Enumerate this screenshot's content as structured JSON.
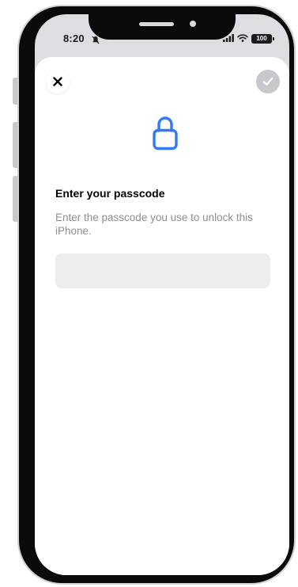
{
  "status_bar": {
    "time": "8:20",
    "battery": "100"
  },
  "sheet": {
    "close_icon": "close-icon",
    "done_icon": "checkmark-icon",
    "lock_icon": "lock-icon",
    "title": "Enter your passcode",
    "description": "Enter the passcode you use to unlock this iPhone.",
    "passcode_field": {
      "value": "",
      "placeholder": ""
    }
  },
  "colors": {
    "accent": "#3478f6",
    "field_background": "#ededf0",
    "secondary_text": "#8e8e93",
    "disabled_button": "#c7c7cc"
  }
}
